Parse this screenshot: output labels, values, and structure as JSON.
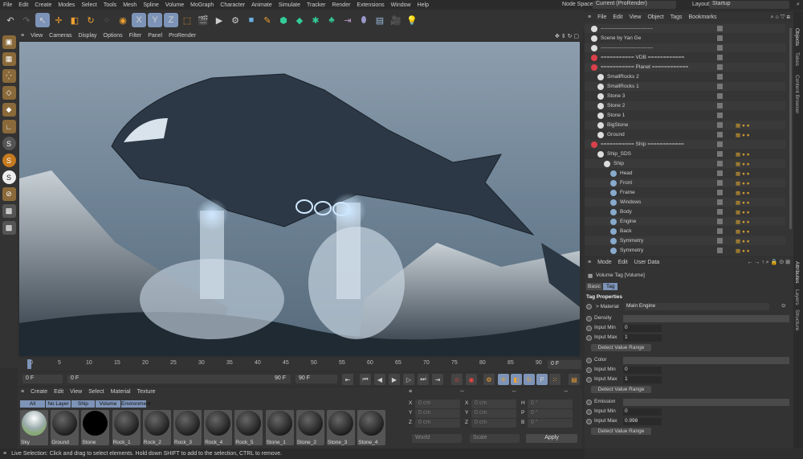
{
  "menu": [
    "File",
    "Edit",
    "Create",
    "Modes",
    "Select",
    "Tools",
    "Mesh",
    "Spline",
    "Volume",
    "MoGraph",
    "Character",
    "Animate",
    "Simulate",
    "Tracker",
    "Render",
    "Extensions",
    "Window",
    "Help"
  ],
  "node_space": {
    "label": "Node Space:",
    "value": "Current (ProRender)"
  },
  "layout": {
    "label": "Layout:",
    "value": "Startup"
  },
  "toolbar_axes": [
    "X",
    "Y",
    "Z"
  ],
  "viewport_menu": [
    "View",
    "Cameras",
    "Display",
    "Options",
    "Filter",
    "Panel",
    "ProRender"
  ],
  "timeline": {
    "ticks": [
      "0",
      "5",
      "10",
      "15",
      "20",
      "25",
      "30",
      "35",
      "40",
      "45",
      "50",
      "55",
      "60",
      "65",
      "70",
      "75",
      "80",
      "85",
      "90"
    ],
    "current": "0 F",
    "start": "0 F",
    "range_start": "0 F",
    "range_end": "90 F",
    "end": "90 F"
  },
  "material_manager": {
    "menu": [
      "Create",
      "Edit",
      "View",
      "Select",
      "Material",
      "Texture"
    ],
    "filters": [
      "All",
      "No Layer",
      "Ship",
      "Volume",
      "Environment"
    ],
    "materials": [
      "Sky",
      "Ground",
      "Stone",
      "Rock_1",
      "Rock_2",
      "Rock_3",
      "Rock_4",
      "Rock_5",
      "Stone_1",
      "Stone_2",
      "Stone_3",
      "Stone_4"
    ]
  },
  "coords": {
    "rows": [
      [
        "X",
        "0 cm",
        "X",
        "0 cm",
        "H",
        "0 °"
      ],
      [
        "Y",
        "0 cm",
        "Y",
        "0 cm",
        "P",
        "0 °"
      ],
      [
        "Z",
        "0 cm",
        "Z",
        "0 cm",
        "B",
        "0 °"
      ]
    ],
    "mode": "World",
    "type": "Scale",
    "apply": "Apply",
    "headers": [
      "--",
      "--",
      "--"
    ]
  },
  "status": "Live Selection: Click and drag to select elements. Hold down SHIFT to add to the selection, CTRL to remove.",
  "object_manager": {
    "menu": [
      "File",
      "Edit",
      "View",
      "Object",
      "Tags",
      "Bookmarks"
    ],
    "objects": [
      {
        "name": "------------------------------",
        "indent": 0
      },
      {
        "name": "Scene by Yan Ge",
        "indent": 0
      },
      {
        "name": "------------------------------",
        "indent": 0
      },
      {
        "name": "=========== VDB ============",
        "indent": 0
      },
      {
        "name": "=========== Planet ============",
        "indent": 0
      },
      {
        "name": "SmallRocks 2",
        "indent": 1
      },
      {
        "name": "SmallRocks 1",
        "indent": 1
      },
      {
        "name": "Stone 3",
        "indent": 1
      },
      {
        "name": "Stone 2",
        "indent": 1
      },
      {
        "name": "Stone 1",
        "indent": 1
      },
      {
        "name": "BigStone",
        "indent": 1
      },
      {
        "name": "Ground",
        "indent": 1
      },
      {
        "name": "=========== Ship ============",
        "indent": 0
      },
      {
        "name": "Ship_SDS",
        "indent": 1
      },
      {
        "name": "Ship",
        "indent": 2
      },
      {
        "name": "Head",
        "indent": 3
      },
      {
        "name": "Front",
        "indent": 3
      },
      {
        "name": "Frame",
        "indent": 3
      },
      {
        "name": "Windows",
        "indent": 3
      },
      {
        "name": "Body",
        "indent": 3
      },
      {
        "name": "Engine",
        "indent": 3
      },
      {
        "name": "Back",
        "indent": 3
      },
      {
        "name": "Symmetry",
        "indent": 3
      },
      {
        "name": "Symmetry",
        "indent": 3
      }
    ]
  },
  "side_tabs_top": [
    "Objects",
    "Takes",
    "Content Browser"
  ],
  "side_tabs_bottom": [
    "Attributes",
    "Layers",
    "Structure"
  ],
  "attributes": {
    "menu": [
      "Mode",
      "Edit",
      "User Data"
    ],
    "title": "Volume Tag [Volume]",
    "tabs": [
      "Basic",
      "Tag"
    ],
    "section": "Tag Properties",
    "material_label": "> Material",
    "material_value": "Main Engine",
    "groups": [
      {
        "name": "Density",
        "min_label": "Input Min",
        "min": "0",
        "max_label": "Input Max",
        "max": "1",
        "button": "Detect Value Range"
      },
      {
        "name": "Color",
        "min_label": "Input Min",
        "min": "0",
        "max_label": "Input Max",
        "max": "1",
        "button": "Detect Value Range"
      },
      {
        "name": "Emission",
        "min_label": "Input Min",
        "min": "0",
        "max_label": "Input Max",
        "max": "0.998",
        "button": "Detect Value Range"
      }
    ]
  },
  "colors": {
    "accent": "#7d94b8",
    "warning": "#d9414a",
    "bg": "#333333"
  }
}
